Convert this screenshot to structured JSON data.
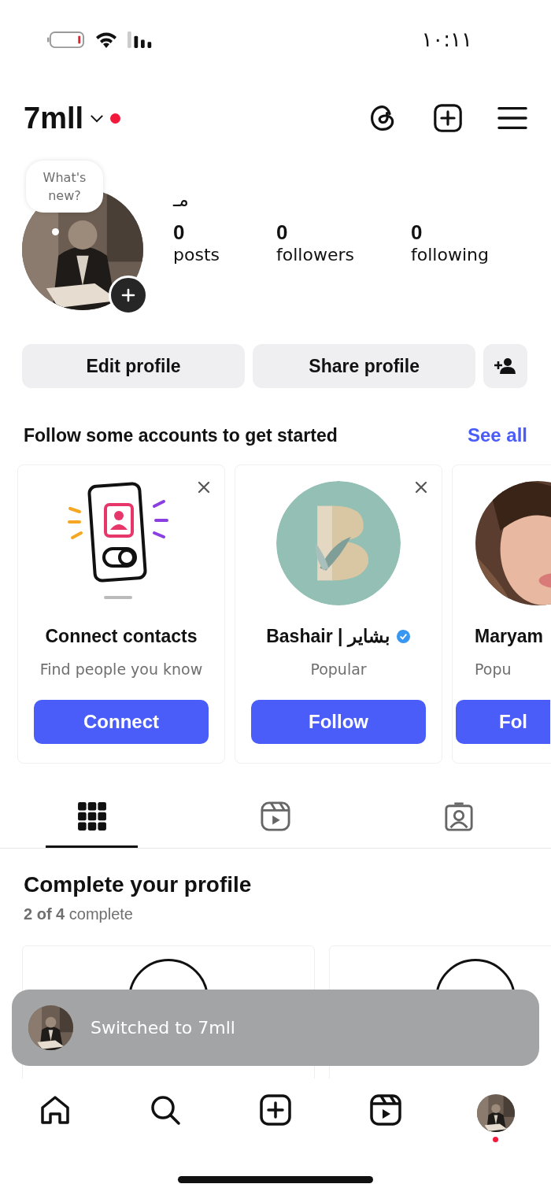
{
  "status_bar": {
    "time": "١٠:١١"
  },
  "header": {
    "username": "7mll",
    "notification_dot": true
  },
  "profile": {
    "bubble": "What's new?",
    "name": "مـ",
    "stats": [
      {
        "value": "0",
        "label": "posts"
      },
      {
        "value": "0",
        "label": "followers"
      },
      {
        "value": "0",
        "label": "following"
      }
    ]
  },
  "actions": [
    {
      "label": "Edit profile"
    },
    {
      "label": "Share profile"
    }
  ],
  "suggestions": {
    "title": "Follow some accounts to get started",
    "link": "See all",
    "cards": [
      {
        "kind": "contacts",
        "title": "Connect contacts",
        "subtitle": "Find people you know",
        "button": "Connect",
        "dismissible": true
      },
      {
        "kind": "account",
        "title": "Bashair | بشاير",
        "verified": true,
        "subtitle": "Popular",
        "button": "Follow",
        "dismissible": true
      },
      {
        "kind": "partial",
        "title": "Maryam",
        "verified": false,
        "subtitle": "Popu",
        "button": "Fol",
        "dismissible": false
      }
    ]
  },
  "tabs": [
    {
      "kind": "grid",
      "selected": true
    },
    {
      "kind": "reels",
      "selected": false
    },
    {
      "kind": "tagged",
      "selected": false
    }
  ],
  "complete": {
    "title": "Complete your profile",
    "progress": "**2 of 4** complete",
    "tasks": [
      {
        "kind": "circle"
      },
      {
        "kind": "circle"
      }
    ]
  },
  "toast": {
    "text": "Switched to 7mll"
  },
  "nav": [
    {
      "kind": "home",
      "notification_dot": false
    },
    {
      "kind": "search",
      "notification_dot": false
    },
    {
      "kind": "create",
      "notification_dot": false
    },
    {
      "kind": "reels",
      "notification_dot": false
    },
    {
      "kind": "profile",
      "notification_dot": true
    }
  ]
}
